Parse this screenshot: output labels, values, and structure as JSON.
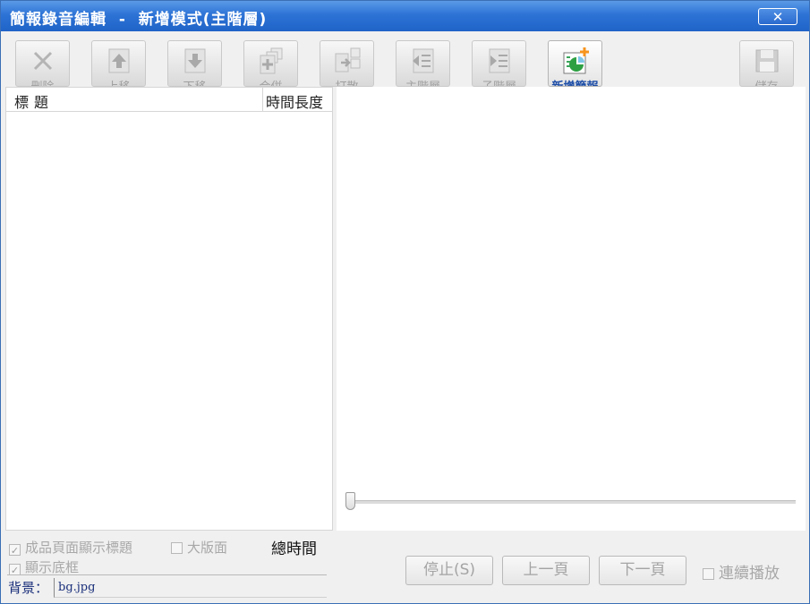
{
  "window": {
    "title": "簡報錄音編輯  -  新增模式(主階層)",
    "close_glyph": "✕"
  },
  "toolbar": {
    "buttons": [
      {
        "label": "刪除",
        "icon": "delete-icon"
      },
      {
        "label": "上移",
        "icon": "move-up-icon"
      },
      {
        "label": "下移",
        "icon": "move-down-icon"
      },
      {
        "label": "合併",
        "icon": "merge-icon"
      },
      {
        "label": "打散",
        "icon": "split-icon"
      },
      {
        "label": "主階層",
        "icon": "main-level-icon"
      },
      {
        "label": "子階層",
        "icon": "sub-level-icon"
      },
      {
        "label": "新增簡報",
        "icon": "add-slide-icon"
      },
      {
        "label": "儲存",
        "icon": "save-icon"
      }
    ]
  },
  "list": {
    "col_title": "標題",
    "col_duration": "時間長度"
  },
  "options": {
    "show_title": "成品頁面顯示標題",
    "large_layout": "大版面",
    "show_frame": "顯示底框",
    "total_time_label": "總時間",
    "checked_glyph": "✓",
    "background_label": "背景：",
    "background_value": "bg.jpg"
  },
  "player": {
    "stop": "停止(S)",
    "prev": "上一頁",
    "next": "下一頁",
    "continuous": "連續播放"
  },
  "colors": {
    "title_bar": "#2d73d6",
    "active_label": "#1f4fa8",
    "accent_orange": "#f7941d",
    "accent_green": "#2ea043"
  }
}
